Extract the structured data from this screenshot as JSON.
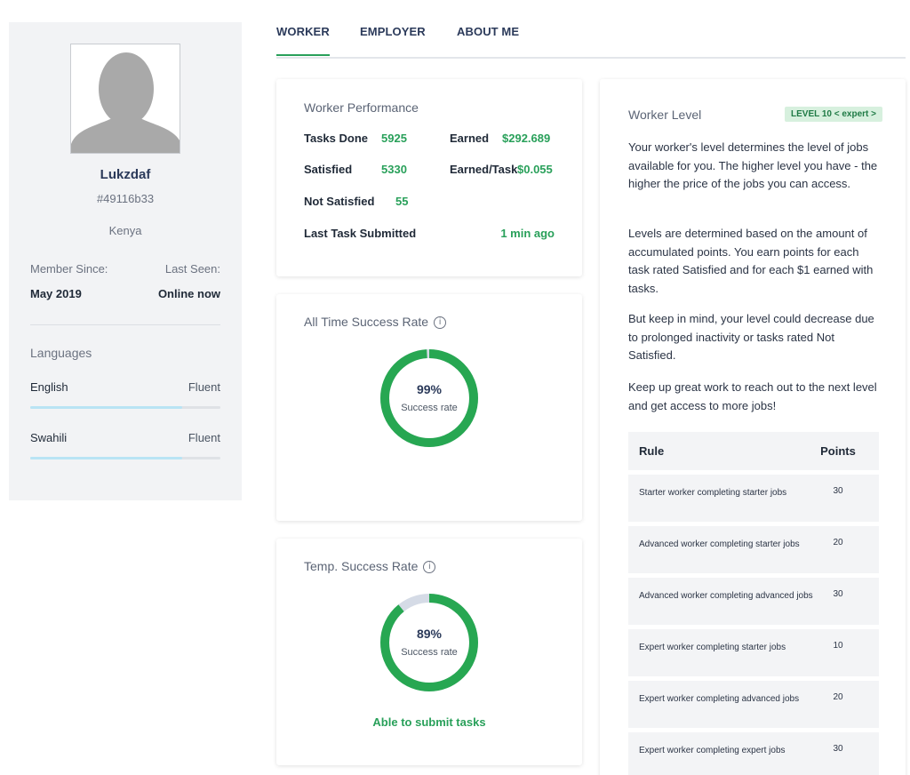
{
  "profile": {
    "username": "Lukzdaf",
    "user_id": "#49116b33",
    "country": "Kenya",
    "member_since_label": "Member Since:",
    "member_since_value": "May 2019",
    "last_seen_label": "Last Seen:",
    "last_seen_value": "Online now",
    "languages_title": "Languages",
    "languages": [
      {
        "name": "English",
        "level": "Fluent",
        "proficiency": 0.8
      },
      {
        "name": "Swahili",
        "level": "Fluent",
        "proficiency": 0.8
      }
    ]
  },
  "tabs": [
    {
      "label": "WORKER",
      "active": true
    },
    {
      "label": "EMPLOYER",
      "active": false
    },
    {
      "label": "ABOUT ME",
      "active": false
    }
  ],
  "performance": {
    "title": "Worker Performance",
    "tasks_done_label": "Tasks Done",
    "tasks_done_value": "5925",
    "earned_label": "Earned",
    "earned_value": "$292.689",
    "satisfied_label": "Satisfied",
    "satisfied_value": "5330",
    "earned_per_task_label": "Earned/Task",
    "earned_per_task_value": "$0.055",
    "not_satisfied_label": "Not Satisfied",
    "not_satisfied_value": "55",
    "last_task_label": "Last Task Submitted",
    "last_task_value": "1 min ago"
  },
  "all_time": {
    "title": "All Time Success Rate",
    "info_icon": "i",
    "percent_label": "99%",
    "percent": 99,
    "sub": "Success rate"
  },
  "temp": {
    "title": "Temp. Success Rate",
    "info_icon": "i",
    "percent_label": "89%",
    "percent": 89,
    "sub": "Success rate",
    "status": "Able to submit tasks"
  },
  "level": {
    "title": "Worker Level",
    "badge": "LEVEL 10 < expert >",
    "para1": "Your worker's level determines the level of jobs available for you. The higher level you have - the higher the price of the jobs you can access.",
    "para2": "Levels are determined based on the amount of accumulated points. You earn points for each task rated Satisfied and for each $1 earned with tasks.",
    "para3": "But keep in mind, your level could decrease due to prolonged inactivity or tasks rated Not Satisfied.",
    "para4": "Keep up great work to reach out to the next level and get access to more jobs!",
    "rules_header_rule": "Rule",
    "rules_header_points": "Points",
    "rules": [
      {
        "rule": "Starter worker completing starter jobs",
        "points": "30"
      },
      {
        "rule": "Advanced worker completing starter jobs",
        "points": "20"
      },
      {
        "rule": "Advanced worker completing advanced jobs",
        "points": "30"
      },
      {
        "rule": "Expert worker completing starter jobs",
        "points": "10"
      },
      {
        "rule": "Expert worker completing advanced jobs",
        "points": "20"
      },
      {
        "rule": "Expert worker completing expert jobs",
        "points": "30"
      }
    ]
  },
  "colors": {
    "accent_green": "#29a05a",
    "ring_green": "#27a752",
    "ring_track": "#d5dbe6",
    "badge_bg": "#d7f0de",
    "language_bar": "#b9e4f4"
  }
}
